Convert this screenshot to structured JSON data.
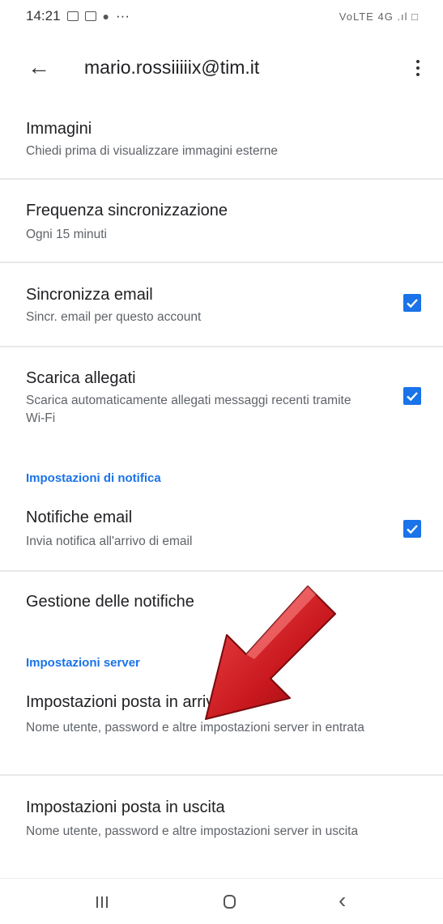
{
  "status_bar": {
    "time": "14:21",
    "more": "···",
    "right_icons": "VoLTE 4G .ıl □"
  },
  "app_bar": {
    "title": "mario.rossiiiiix@tim.it",
    "back_icon": "←"
  },
  "settings": {
    "images": {
      "title": "Immagini",
      "subtitle": "Chiedi prima di visualizzare immagini esterne"
    },
    "sync_frequency": {
      "title": "Frequenza sincronizzazione",
      "subtitle": "Ogni 15 minuti"
    },
    "sync_email": {
      "title": "Sincronizza email",
      "subtitle": "Sincr. email per questo account",
      "checked": true
    },
    "download_attachments": {
      "title": "Scarica allegati",
      "subtitle": "Scarica automaticamente allegati messaggi recenti tramite Wi-Fi",
      "checked": true
    },
    "notification_section": "Impostazioni di notifica",
    "email_notifications": {
      "title": "Notifiche email",
      "subtitle": "Invia notifica all'arrivo di email",
      "checked": true
    },
    "manage_notifications": {
      "title": "Gestione delle notifiche"
    },
    "server_section": "Impostazioni server",
    "incoming": {
      "title": "Impostazioni posta in arrivo",
      "subtitle": "Nome utente, password e altre impostazioni server in entrata"
    },
    "outgoing": {
      "title": "Impostazioni posta in uscita",
      "subtitle": "Nome utente, password e altre impostazioni server in uscita"
    }
  },
  "colors": {
    "accent": "#1a73e8",
    "arrow": "#c8181e"
  },
  "nav_bar": {
    "back_glyph": "‹"
  }
}
